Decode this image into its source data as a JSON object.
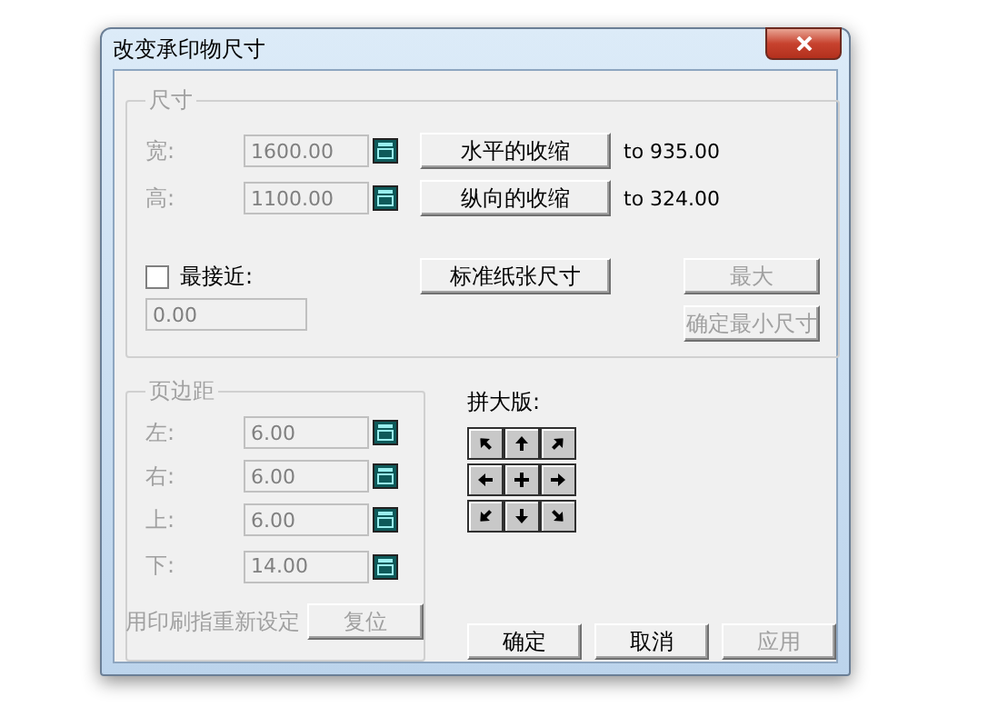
{
  "window": {
    "title": "改变承印物尺寸"
  },
  "size_group": {
    "title": "尺寸",
    "rows": [
      {
        "label": "宽:",
        "value": "1600.00",
        "disabled": true,
        "button": "水平的收缩",
        "result": "to 935.00"
      },
      {
        "label": "高:",
        "value": "1100.00",
        "disabled": true,
        "button": "纵向的收缩",
        "result": "to 324.00"
      }
    ],
    "nearest": {
      "label": "最接近:",
      "checked": false,
      "value": "0.00"
    },
    "standard_button": {
      "label": "标准纸张尺寸",
      "disabled": false
    },
    "side_buttons": [
      {
        "label": "最大",
        "disabled": true
      },
      {
        "label": "确定最小尺寸",
        "disabled": true
      }
    ]
  },
  "margin_group": {
    "title": "页边距",
    "rows": [
      {
        "label": "左:",
        "value": "6.00",
        "disabled": true
      },
      {
        "label": "右:",
        "value": "6.00",
        "disabled": true
      },
      {
        "label": "上:",
        "value": "6.00",
        "disabled": true
      },
      {
        "label": "下:",
        "value": "14.00",
        "disabled": true
      }
    ],
    "reset_label": "用印刷指重新设定",
    "reset_button": {
      "label": "复位",
      "disabled": true
    }
  },
  "tiling": {
    "label": "拼大版:"
  },
  "footer_buttons": [
    {
      "label": "确定",
      "disabled": false
    },
    {
      "label": "取消",
      "disabled": false
    },
    {
      "label": "应用",
      "disabled": true
    }
  ]
}
